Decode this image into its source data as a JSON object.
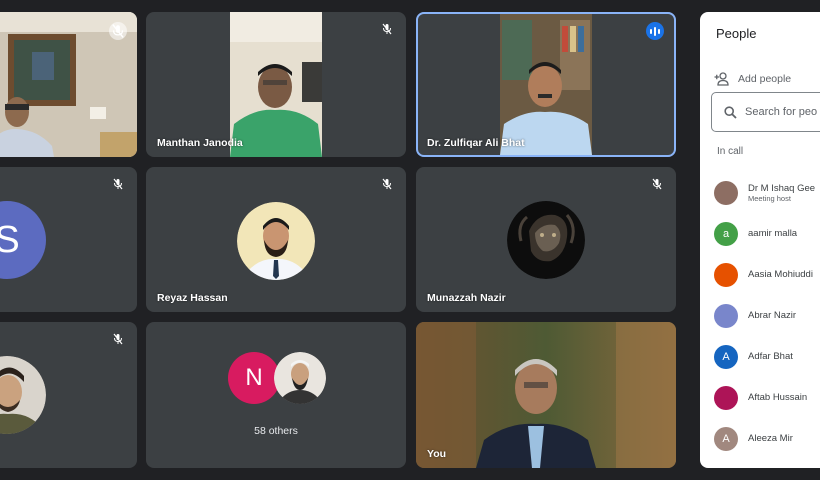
{
  "tiles": {
    "t1": {
      "name": ""
    },
    "t2": {
      "name": "Manthan Janodia"
    },
    "t3": {
      "name": "Dr. Zulfiqar Ali Bhat"
    },
    "t4": {
      "name": "",
      "initial": "S"
    },
    "t5": {
      "name": "Reyaz Hassan"
    },
    "t6": {
      "name": "Munazzah Nazir"
    },
    "t7": {
      "name": ""
    },
    "t8": {
      "initial": "N",
      "others": "58 others"
    },
    "t9": {
      "name": "You"
    }
  },
  "panel": {
    "title": "People",
    "add_people": "Add people",
    "search_placeholder": "Search for peo",
    "section": "In call",
    "participants": [
      {
        "name": "Dr M Ishaq Gee",
        "sub": "Meeting host",
        "initial": "",
        "color": "#8d6e63"
      },
      {
        "name": "aamir malla",
        "sub": "",
        "initial": "a",
        "color": "#43a047"
      },
      {
        "name": "Aasia Mohiuddi",
        "sub": "",
        "initial": "",
        "color": "#e65100"
      },
      {
        "name": "Abrar Nazir",
        "sub": "",
        "initial": "",
        "color": "#7986cb"
      },
      {
        "name": "Adfar Bhat",
        "sub": "",
        "initial": "A",
        "color": "#1565c0"
      },
      {
        "name": "Aftab Hussain",
        "sub": "",
        "initial": "",
        "color": "#ad1457"
      },
      {
        "name": "Aleeza Mir",
        "sub": "",
        "initial": "A",
        "color": "#a1887f"
      }
    ]
  },
  "colors": {
    "accent": "#1a73e8",
    "tile": "#3c4043",
    "background": "#202124"
  }
}
